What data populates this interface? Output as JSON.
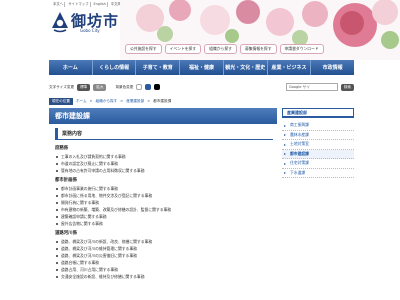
{
  "header": {
    "top_links": [
      "本文へ",
      "サイトマップ",
      "English",
      "中文简体",
      "中文繁體",
      "한국어"
    ],
    "title": "御坊市",
    "subtitle": "Gobo City",
    "quick_links": [
      "公共施設を探す",
      "イベントを探す",
      "組織から探す",
      "募集情報を探す",
      "申請書ダウンロード"
    ]
  },
  "gnav": [
    "ホーム",
    "くらしの情報",
    "子育て・教育",
    "福祉・健康",
    "観光・文化・歴史",
    "産業・ビジネス",
    "市政情報"
  ],
  "tools": {
    "text_size_label": "文字サイズ変更",
    "standard": "標準",
    "larger": "拡大",
    "bg_label": "背景色変更",
    "search_value": "Google サイ",
    "search_button": "検索"
  },
  "breadcrumb": {
    "here_label": "現在の位置",
    "items": [
      "ホーム",
      "組織から探す",
      "産業建設部"
    ],
    "current": "都市建設課"
  },
  "page_title": "都市建設課",
  "section_title": "業務内容",
  "departments": [
    {
      "name": "庶務係",
      "tasks": [
        "工事の入札及び請負契約に関する事務",
        "市道の認定及び廃止に関する事務",
        "管有地の占有許可申請の占用料徴収に関する事務"
      ]
    },
    {
      "name": "都市計画係",
      "tasks": [
        "都市計画事業の施行に関する事務",
        "都市計画に係る用地、物件交渉及び登記に関する事務",
        "開発行為に関する事務",
        "市有建物の新築、増築、改築及び修繕の設計、監督に関する事務",
        "建築確認申請に関する事務",
        "屋外広告物に関する事務"
      ]
    },
    {
      "name": "道路河川係",
      "tasks": [
        "道路、橋梁及び河川の新設、改良、修繕に関する事務",
        "道路、橋梁及び河川の維持管理に関する事務",
        "道路、橋梁及び河川の災害復旧に関する事務",
        "道路台帳に関する事務",
        "道路占用、河川占用に関する事務",
        "交通安全施設の新設、維持及び修繕に関する事務"
      ]
    }
  ],
  "side": {
    "heading": "産業建設部",
    "items": [
      "商工振興課",
      "農林水産課",
      "土地対策室",
      "都市建設課",
      "住宅対策課",
      "下水道課"
    ],
    "active_index": 3
  }
}
